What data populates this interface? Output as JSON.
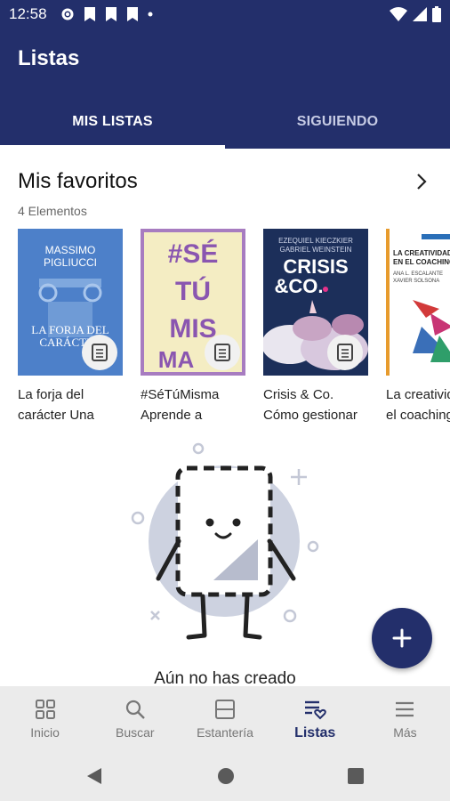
{
  "status_bar": {
    "time": "12:58"
  },
  "header": {
    "title": "Listas",
    "tabs": [
      {
        "label": "MIS LISTAS",
        "active": true
      },
      {
        "label": "SIGUIENDO",
        "active": false
      }
    ]
  },
  "section": {
    "title": "Mis favoritos",
    "count": "4 Elementos"
  },
  "books": [
    {
      "title_line1": "La forja del",
      "title_line2": "carácter Una",
      "cover_author": "MASSIMO PIGLIUCCI",
      "cover_title": "LA FORJA DEL CARÁCTER"
    },
    {
      "title_line1": "#SéTúMisma",
      "title_line2": "Aprende a",
      "cover_title": "#SÉ TÚ MIS MA"
    },
    {
      "title_line1": "Crisis & Co.",
      "title_line2": "Cómo gestionar",
      "cover_author": "EZEQUIEL KIECZKIER GABRIEL WEINSTEIN",
      "cover_title": "CRISIS &CO."
    },
    {
      "title_line1": "La creatividad en",
      "title_line2": "el coaching",
      "cover_title": "LA CREATIVIDAD EN EL COACHING"
    }
  ],
  "empty_state": {
    "text": "Aún no has creado"
  },
  "bottom_nav": [
    {
      "label": "Inicio",
      "icon": "grid-icon",
      "active": false
    },
    {
      "label": "Buscar",
      "icon": "search-icon",
      "active": false
    },
    {
      "label": "Estantería",
      "icon": "shelf-icon",
      "active": false
    },
    {
      "label": "Listas",
      "icon": "list-heart-icon",
      "active": true
    },
    {
      "label": "Más",
      "icon": "menu-icon",
      "active": false
    }
  ],
  "colors": {
    "primary": "#232f6b",
    "accent_dark": "#232f6b",
    "nav_bg": "#ebebeb"
  }
}
